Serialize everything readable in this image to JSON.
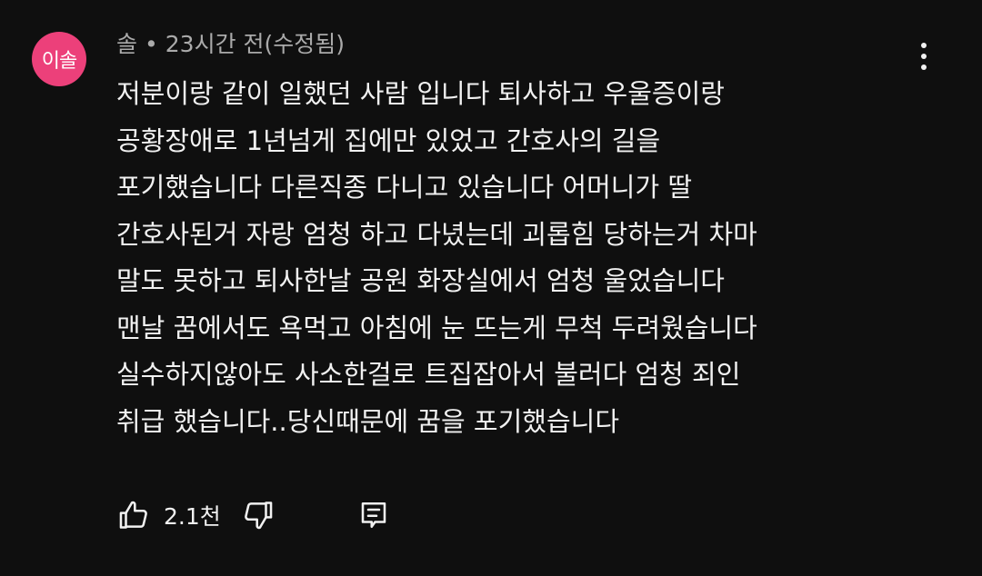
{
  "comment": {
    "avatar_text": "이솔",
    "avatar_color": "#ec407a",
    "author": "솔",
    "separator": "•",
    "time": "23시간 전(수정됨)",
    "lines": [
      "저분이랑 같이 일했던 사람 입니다 퇴사하고 우울증이랑",
      "공황장애로 1년넘게 집에만 있었고 간호사의 길을",
      "포기했습니다 다른직종 다니고 있습니다 어머니가 딸",
      "간호사된거 자랑 엄청 하고 다녔는데 괴롭힘 당하는거 차마",
      "말도 못하고 퇴사한날 공원 화장실에서 엄청 울었습니다",
      "맨날 꿈에서도 욕먹고 아침에 눈 뜨는게 무척 두려웠습니다",
      "실수하지않아도 사소한걸로 트집잡아서 불러다 엄청 죄인",
      "취급 했습니다..당신때문에 꿈을 포기했습니다"
    ],
    "like_count": "2.1천",
    "icons": {
      "like": "thumbs-up-icon",
      "dislike": "thumbs-down-icon",
      "reply": "reply-comment-icon",
      "menu": "more-vert-icon"
    }
  }
}
